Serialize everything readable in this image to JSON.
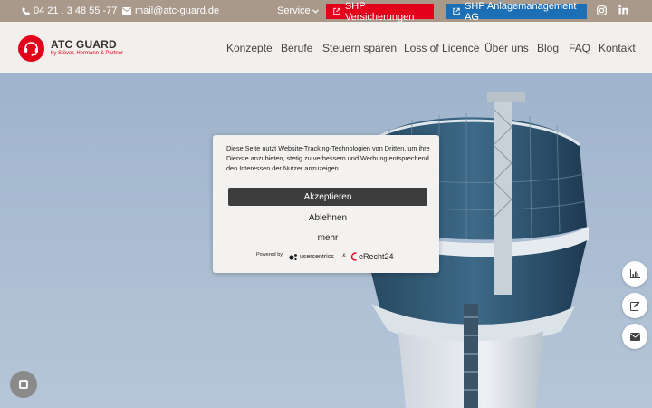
{
  "topbar": {
    "phone": "04 21 . 3 48 55 -77",
    "email": "mail@atc-guard.de",
    "service_label": "Service",
    "btn_versicherungen": "SHP Versicherungen",
    "btn_anlagemanagement": "SHP Anlagemanagement AG",
    "social": [
      "instagram-icon",
      "linkedin-icon"
    ]
  },
  "header": {
    "logo_title": "ATC GUARD",
    "logo_sub": "by Stöver, Hermann & Partner",
    "nav": [
      "Konzepte",
      "Berufe",
      "Steuern sparen",
      "Loss of Licence",
      "Über uns",
      "Blog",
      "FAQ",
      "Kontakt"
    ]
  },
  "consent": {
    "text": "Diese Seite nutzt Website-Tracking-Technologien von Dritten, um ihre Dienste anzubieten, stetig zu verbessern und Werbung entsprechend den Interessen der Nutzer anzuzeigen.",
    "accept": "Akzeptieren",
    "decline": "Ablehnen",
    "more": "mehr",
    "powered_by": "Powered by",
    "usercentrics": "usercentrics",
    "amp": "&",
    "erecht": "eRecht24"
  },
  "side_buttons": [
    "chart-icon",
    "edit-icon",
    "envelope-icon"
  ],
  "colors": {
    "brand_red": "#e2001a",
    "brand_blue": "#1c6fb5",
    "topbar": "#a8998b",
    "header_bg": "#f2efec"
  }
}
